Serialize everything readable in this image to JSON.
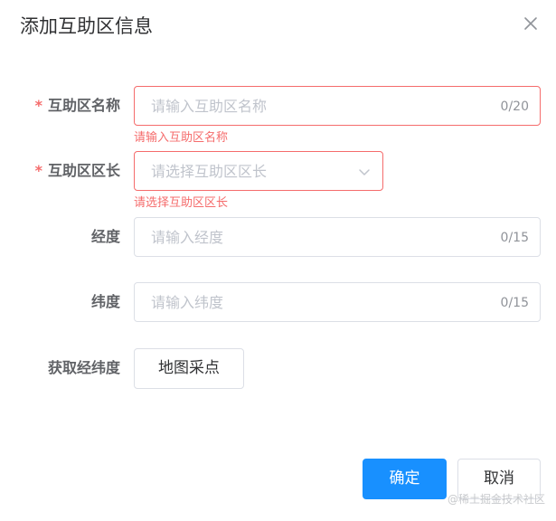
{
  "dialog": {
    "title": "添加互助区信息",
    "close_icon": "close-icon"
  },
  "form": {
    "name": {
      "required_mark": "*",
      "label": "互助区名称",
      "placeholder": "请输入互助区名称",
      "value": "",
      "counter": "0/20",
      "error": "请输入互助区名称"
    },
    "leader": {
      "required_mark": "*",
      "label": "互助区区长",
      "placeholder": "请选择互助区区长",
      "value": "",
      "dropdown_icon": "chevron-down-icon",
      "error": "请选择互助区区长"
    },
    "longitude": {
      "label": "经度",
      "placeholder": "请输入经度",
      "value": "",
      "counter": "0/15"
    },
    "latitude": {
      "label": "纬度",
      "placeholder": "请输入纬度",
      "value": "",
      "counter": "0/15"
    },
    "coords": {
      "label": "获取经纬度",
      "button": "地图采点"
    }
  },
  "footer": {
    "confirm": "确定",
    "cancel": "取消"
  },
  "watermark": "@稀土掘金技术社区",
  "colors": {
    "primary": "#1890ff",
    "error": "#f56c6c",
    "border": "#dcdfe6",
    "placeholder": "#c0c4cc"
  }
}
